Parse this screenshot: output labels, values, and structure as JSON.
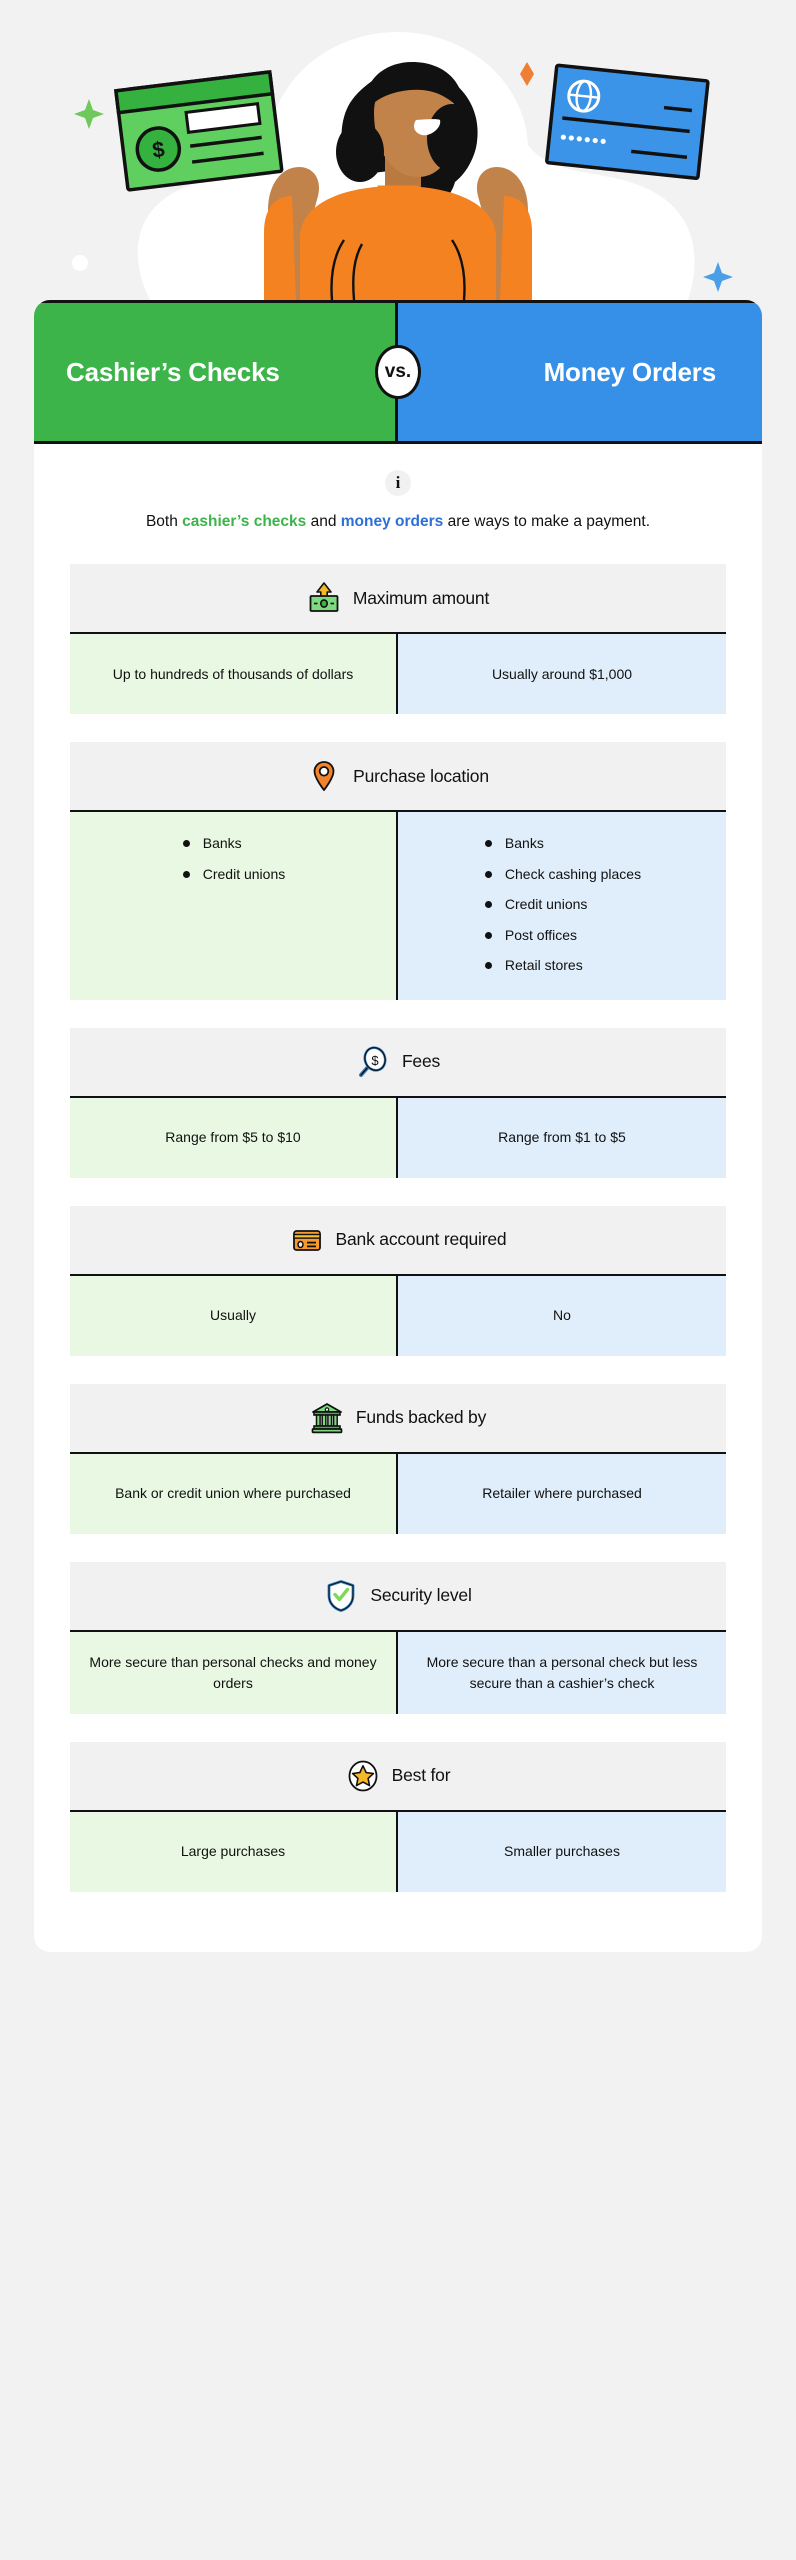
{
  "hero": {
    "alt": "Woman with arms raised between a green cashier's check and a blue money order",
    "check_symbol": "$",
    "money_order_dots": "••••••"
  },
  "header": {
    "left_title": "Cashier’s Checks",
    "vs_label": "vs.",
    "right_title": "Money Orders"
  },
  "intro": {
    "info_glyph": "i",
    "prefix": "Both ",
    "term_green": "cashier’s checks",
    "middle": " and ",
    "term_blue": "money orders",
    "suffix": " are ways to make a payment."
  },
  "colors": {
    "green": "#3cb44a",
    "blue": "#3690e8",
    "green_cell": "#e9f8e3",
    "blue_cell": "#e0eefb",
    "head_grey": "#f1f1f1",
    "page_bg": "#f2f2f2",
    "orange": "#f2832a",
    "gold": "#f5b828",
    "ink": "#111111"
  },
  "rows": [
    {
      "icon": "money-bill-up-arrow-icon",
      "label": "Maximum amount",
      "type": "text",
      "left": "Up to hundreds of thousands of dollars",
      "right": "Usually around $1,000"
    },
    {
      "icon": "map-pin-icon",
      "label": "Purchase location",
      "type": "list",
      "left_items": [
        "Banks",
        "Credit unions"
      ],
      "right_items": [
        "Banks",
        "Check cashing places",
        "Credit unions",
        "Post offices",
        "Retail stores"
      ]
    },
    {
      "icon": "magnifier-dollar-icon",
      "label": "Fees",
      "type": "text",
      "left": "Range from $5 to $10",
      "right": "Range from $1 to $5"
    },
    {
      "icon": "credit-card-icon",
      "label": "Bank account required",
      "type": "text",
      "left": "Usually",
      "right": "No"
    },
    {
      "icon": "bank-building-icon",
      "label": "Funds backed by",
      "type": "text",
      "left": "Bank or credit union where purchased",
      "right": "Retailer where purchased"
    },
    {
      "icon": "shield-check-icon",
      "label": "Security level",
      "type": "text",
      "left": "More secure than personal checks and money orders",
      "right": "More secure than a personal check but less secure than a cashier’s check"
    },
    {
      "icon": "star-circle-icon",
      "label": "Best for",
      "type": "text",
      "left": "Large purchases",
      "right": "Smaller purchases"
    }
  ]
}
